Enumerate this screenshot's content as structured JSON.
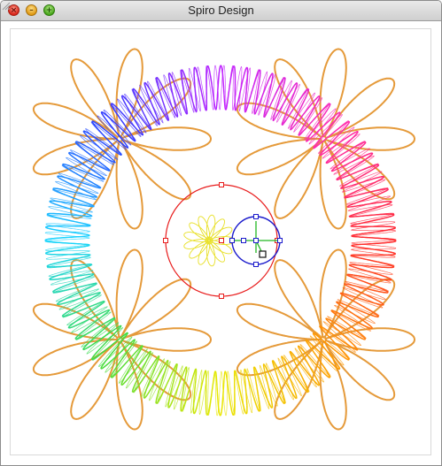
{
  "window": {
    "title": "Spiro Design",
    "buttons": [
      {
        "name": "close",
        "glyph": "×",
        "color": "#d8261a"
      },
      {
        "name": "minimize",
        "glyph": "–",
        "color": "#e09a14"
      },
      {
        "name": "zoom",
        "glyph": "+",
        "color": "#46a41a"
      }
    ]
  },
  "design": {
    "flower_color": "#e59a3a",
    "flower_center_color": "#e59a3a",
    "flower_petals": 9,
    "flower_count": 4,
    "ring_colors": [
      "#ff2a2a",
      "#ff9a00",
      "#e8e800",
      "#3fdc3f",
      "#19d4ff",
      "#2a3cff",
      "#c020ff",
      "#ff2ab0"
    ],
    "inner_pattern_color": "#e8e028",
    "outer_guide_circle_color": "#e81c1c",
    "rolling_circle_color": "#1c1ccc",
    "pen_arm_color": "#22b822",
    "handle_color": "#1c1ccc"
  }
}
